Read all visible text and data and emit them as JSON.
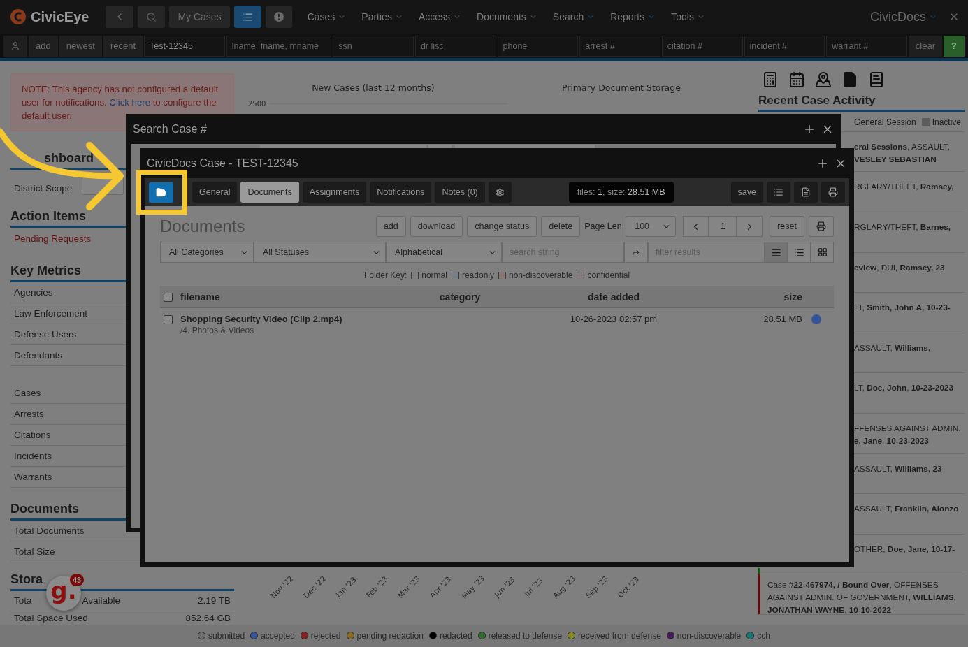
{
  "header": {
    "logo": "CivicEye",
    "buttons": [
      {
        "kind": "back",
        "selected": false
      },
      {
        "kind": "search",
        "selected": false
      },
      {
        "kind": "text",
        "label": "My Cases",
        "selected": false
      },
      {
        "kind": "list",
        "selected": true
      },
      {
        "kind": "alert",
        "selected": false
      }
    ],
    "menus": [
      {
        "label": "Cases",
        "highlighted": false
      },
      {
        "label": "Parties",
        "highlighted": false
      },
      {
        "label": "Access",
        "highlighted": false
      },
      {
        "label": "Documents",
        "highlighted": false
      },
      {
        "label": "Search",
        "highlighted": true
      },
      {
        "label": "Reports",
        "highlighted": true
      },
      {
        "label": "Tools",
        "highlighted": false
      }
    ],
    "app_switcher": "CivicDocs"
  },
  "quick_search": {
    "buttons": [
      "add",
      "newest",
      "recent"
    ],
    "fields": [
      {
        "value": "Test-12345"
      },
      {
        "placeholder": "lname, fname, mname"
      },
      {
        "placeholder": "ssn"
      },
      {
        "placeholder": "dr lisc"
      },
      {
        "placeholder": "phone"
      },
      {
        "placeholder": "arrest #"
      },
      {
        "placeholder": "citation #"
      },
      {
        "placeholder": "incident #"
      },
      {
        "placeholder": "warrant #"
      }
    ],
    "clear": "clear",
    "help": "?"
  },
  "notice": {
    "before": "NOTE: This agency has not configured a default user for notifications.",
    "link": "Click here",
    "after": "to configure the default user."
  },
  "sidebar": {
    "dashboard_heading": "shboard",
    "district_label": "District Scope",
    "sections": [
      {
        "heading": "Action Items",
        "groups": [
          [
            {
              "label": "Pending Requests",
              "kind": "link"
            }
          ]
        ]
      },
      {
        "heading": "Key Metrics",
        "groups": [
          [
            {
              "label": "Agencies",
              "kind": "row"
            },
            {
              "label": "Law Enforcement",
              "kind": "row"
            },
            {
              "label": "Defense Users",
              "kind": "row"
            },
            {
              "label": "Defendants",
              "kind": "row"
            }
          ],
          [
            {
              "label": "Cases",
              "kind": "row"
            },
            {
              "label": "Arrests",
              "kind": "row"
            },
            {
              "label": "Citations",
              "kind": "row"
            },
            {
              "label": "Incidents",
              "kind": "row"
            },
            {
              "label": "Warrants",
              "kind": "row"
            }
          ]
        ]
      },
      {
        "heading": "Documents",
        "groups": [
          [
            {
              "label": "Total Documents",
              "kind": "row"
            },
            {
              "label": "Total Size",
              "kind": "row"
            }
          ]
        ]
      }
    ],
    "storage": {
      "heading": "Stora",
      "rows": [
        {
          "label": "Tota",
          "label_after": "Available",
          "value": "2.19 TB"
        },
        {
          "label": "Total Space Used",
          "value": "852.64 GB"
        }
      ]
    }
  },
  "helper_widget": {
    "logo": "g.",
    "count": "43"
  },
  "charts": {
    "new_cases": {
      "title": "New Cases (last 12 months)",
      "y_tick": "2500",
      "months": [
        "Nov '22",
        "Dec '22",
        "Jan '23",
        "Feb '23",
        "Mar '23",
        "Apr '23",
        "May '23",
        "Jun '23",
        "Jul '23",
        "Aug '23",
        "Sep '23",
        "Oct '23"
      ]
    },
    "storage": {
      "title": "Primary Document Storage"
    }
  },
  "recent_activity": {
    "heading": "Recent Case Activity",
    "legend": [
      {
        "label": "General Session"
      },
      {
        "label": "Inactive",
        "color": "#5c5c5c"
      }
    ],
    "entries": [
      {
        "kind": "partial",
        "text": "**eral Sessions**, ASSAULT, **VESLEY SEBASTIAN**"
      },
      {
        "kind": "partial",
        "text": "RGLARY/THEFT, **Ramsey,**"
      },
      {
        "kind": "partial",
        "text": "RGLARY/THEFT, **Barnes,**"
      },
      {
        "kind": "partial",
        "text": "**eview**, DUI, **Ramsey, 23**"
      },
      {
        "kind": "partial",
        "text": "LT, **Smith, John A, 10-23-**"
      },
      {
        "kind": "partial",
        "text": "ASSAULT, **Williams,**"
      },
      {
        "kind": "partial",
        "text": "LT, **Doe, John**, **10-23-2023**"
      },
      {
        "kind": "partial",
        "text": "FFENSES AGAINST ADMIN. **e, Jane**, **10-23-2023**"
      },
      {
        "kind": "partial",
        "text": "ASSAULT, **Williams, 23**"
      },
      {
        "kind": "partial",
        "text": "ASSAULT, **Franklin, Alonzo**"
      },
      {
        "kind": "partial",
        "text": "OTHER, **Doe, Jane, 10-17-**",
        "color": "#0a5a0a"
      },
      {
        "kind": "full",
        "text": "Case #**22-467974, / Bound Over**, OFFENSES AGAINST ADMIN. OF GOVERNMENT, **WILLIAMS, JONATHAN WAYNE**, **10-10-2022**",
        "color": "#6a0a0a"
      }
    ]
  },
  "search_modal": {
    "title": "Search Case #"
  },
  "case_modal": {
    "title": "CivicDocs Case - TEST-12345",
    "tabs": [
      {
        "label": "General",
        "selected": false
      },
      {
        "label": "Documents",
        "selected": true
      },
      {
        "label": "Assignments",
        "selected": false
      },
      {
        "label": "Notifications",
        "selected": false
      },
      {
        "label": "Notes (0)",
        "selected": false
      }
    ],
    "file_info": "files: **1**, size: **28.51 MB**",
    "save": "save",
    "documents": {
      "heading": "Documents",
      "buttons": [
        "add",
        "download",
        "change status",
        "delete"
      ],
      "page_len_label": "Page Len:",
      "page_len": "100",
      "page": "1",
      "reset": "reset",
      "filters": [
        "All Categories",
        "All Statuses",
        "Alphabetical"
      ],
      "search_placeholder": "search string",
      "filter_placeholder": "filter results",
      "views": [
        {
          "kind": "table",
          "selected": true
        },
        {
          "kind": "list",
          "selected": false
        },
        {
          "kind": "grid",
          "selected": false
        }
      ],
      "folder_key_label": "Folder Key:",
      "folder_key": [
        {
          "label": "normal",
          "color": "#7e7e7e"
        },
        {
          "label": "readonly",
          "color": "#78818a"
        },
        {
          "label": "non-discoverable",
          "color": "#8a7575"
        },
        {
          "label": "confidential",
          "color": "#867a82"
        }
      ],
      "header_checked": false,
      "columns": [
        "filename",
        "category",
        "date added",
        "size"
      ],
      "rows": [
        {
          "checked": false,
          "filename": "Shopping Security Video (Clip 2.mp4)",
          "path": "/4. Photos & Videos",
          "date_added": "10-26-2023 02:57 pm",
          "size": "28.51 MB",
          "color": "#34559a"
        }
      ]
    }
  },
  "status_legend": [
    {
      "label": "submitted",
      "color": "#6f6f6f"
    },
    {
      "label": "accepted",
      "color": "#34559a"
    },
    {
      "label": "rejected",
      "color": "#8a2020"
    },
    {
      "label": "pending redaction",
      "color": "#8a6a20"
    },
    {
      "label": "redacted",
      "color": "#000000"
    },
    {
      "label": "released to defense",
      "color": "#2e6e2e"
    },
    {
      "label": "received from defense",
      "color": "#8a8a20"
    },
    {
      "label": "non-discoverable",
      "color": "#4a1a5a"
    },
    {
      "label": "cch",
      "color": "#1a7a7a"
    }
  ]
}
